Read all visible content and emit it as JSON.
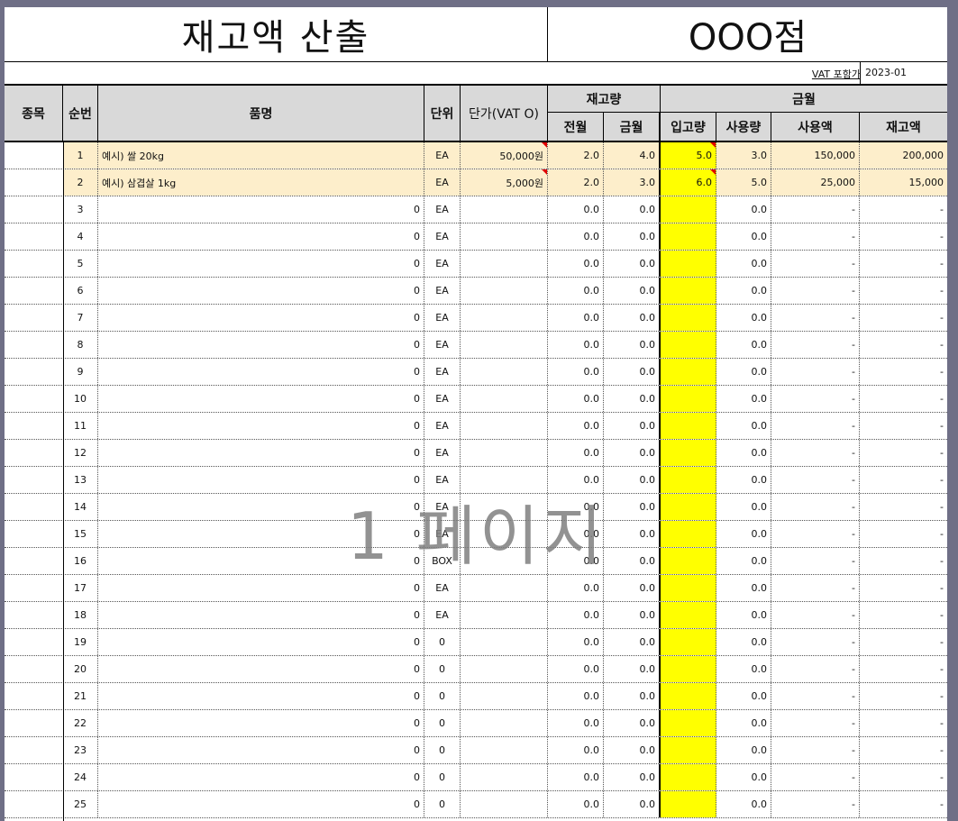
{
  "title": "재고액 산출",
  "store": "OOO점",
  "vat_label": "VAT 포함가",
  "period": "2023-01",
  "headers": {
    "category": "종목",
    "seq": "순번",
    "item": "품명",
    "unit": "단위",
    "unit_price": "단가(VAT O)",
    "stock_group": "재고량",
    "prev_month": "전월",
    "this_month": "금월",
    "amount_group": "금월",
    "inbound": "입고량",
    "usage": "사용량",
    "usage_amount": "사용액",
    "stock_amount": "재고액"
  },
  "rows": [
    {
      "seq": "1",
      "item": "예시) 쌀 20kg",
      "unit": "EA",
      "price": "50,000원",
      "prev": "2.0",
      "cur": "4.0",
      "inbound": "5.0",
      "usage": "3.0",
      "usage_amt": "150,000",
      "stock_amt": "200,000"
    },
    {
      "seq": "2",
      "item": "예시) 삼겹살 1kg",
      "unit": "EA",
      "price": "5,000원",
      "prev": "2.0",
      "cur": "3.0",
      "inbound": "6.0",
      "usage": "5.0",
      "usage_amt": "25,000",
      "stock_amt": "15,000"
    },
    {
      "seq": "3",
      "item": "0",
      "unit": "EA",
      "price": "",
      "prev": "0.0",
      "cur": "0.0",
      "inbound": "",
      "usage": "0.0",
      "usage_amt": "-",
      "stock_amt": "-"
    },
    {
      "seq": "4",
      "item": "0",
      "unit": "EA",
      "price": "",
      "prev": "0.0",
      "cur": "0.0",
      "inbound": "",
      "usage": "0.0",
      "usage_amt": "-",
      "stock_amt": "-"
    },
    {
      "seq": "5",
      "item": "0",
      "unit": "EA",
      "price": "",
      "prev": "0.0",
      "cur": "0.0",
      "inbound": "",
      "usage": "0.0",
      "usage_amt": "-",
      "stock_amt": "-"
    },
    {
      "seq": "6",
      "item": "0",
      "unit": "EA",
      "price": "",
      "prev": "0.0",
      "cur": "0.0",
      "inbound": "",
      "usage": "0.0",
      "usage_amt": "-",
      "stock_amt": "-"
    },
    {
      "seq": "7",
      "item": "0",
      "unit": "EA",
      "price": "",
      "prev": "0.0",
      "cur": "0.0",
      "inbound": "",
      "usage": "0.0",
      "usage_amt": "-",
      "stock_amt": "-"
    },
    {
      "seq": "8",
      "item": "0",
      "unit": "EA",
      "price": "",
      "prev": "0.0",
      "cur": "0.0",
      "inbound": "",
      "usage": "0.0",
      "usage_amt": "-",
      "stock_amt": "-"
    },
    {
      "seq": "9",
      "item": "0",
      "unit": "EA",
      "price": "",
      "prev": "0.0",
      "cur": "0.0",
      "inbound": "",
      "usage": "0.0",
      "usage_amt": "-",
      "stock_amt": "-"
    },
    {
      "seq": "10",
      "item": "0",
      "unit": "EA",
      "price": "",
      "prev": "0.0",
      "cur": "0.0",
      "inbound": "",
      "usage": "0.0",
      "usage_amt": "-",
      "stock_amt": "-"
    },
    {
      "seq": "11",
      "item": "0",
      "unit": "EA",
      "price": "",
      "prev": "0.0",
      "cur": "0.0",
      "inbound": "",
      "usage": "0.0",
      "usage_amt": "-",
      "stock_amt": "-"
    },
    {
      "seq": "12",
      "item": "0",
      "unit": "EA",
      "price": "",
      "prev": "0.0",
      "cur": "0.0",
      "inbound": "",
      "usage": "0.0",
      "usage_amt": "-",
      "stock_amt": "-"
    },
    {
      "seq": "13",
      "item": "0",
      "unit": "EA",
      "price": "",
      "prev": "0.0",
      "cur": "0.0",
      "inbound": "",
      "usage": "0.0",
      "usage_amt": "-",
      "stock_amt": "-"
    },
    {
      "seq": "14",
      "item": "0",
      "unit": "EA",
      "price": "",
      "prev": "0.0",
      "cur": "0.0",
      "inbound": "",
      "usage": "0.0",
      "usage_amt": "-",
      "stock_amt": "-"
    },
    {
      "seq": "15",
      "item": "0",
      "unit": "EA",
      "price": "",
      "prev": "0.0",
      "cur": "0.0",
      "inbound": "",
      "usage": "0.0",
      "usage_amt": "-",
      "stock_amt": "-"
    },
    {
      "seq": "16",
      "item": "0",
      "unit": "BOX",
      "price": "",
      "prev": "0.0",
      "cur": "0.0",
      "inbound": "",
      "usage": "0.0",
      "usage_amt": "-",
      "stock_amt": "-"
    },
    {
      "seq": "17",
      "item": "0",
      "unit": "EA",
      "price": "",
      "prev": "0.0",
      "cur": "0.0",
      "inbound": "",
      "usage": "0.0",
      "usage_amt": "-",
      "stock_amt": "-"
    },
    {
      "seq": "18",
      "item": "0",
      "unit": "EA",
      "price": "",
      "prev": "0.0",
      "cur": "0.0",
      "inbound": "",
      "usage": "0.0",
      "usage_amt": "-",
      "stock_amt": "-"
    },
    {
      "seq": "19",
      "item": "0",
      "unit": "0",
      "price": "",
      "prev": "0.0",
      "cur": "0.0",
      "inbound": "",
      "usage": "0.0",
      "usage_amt": "-",
      "stock_amt": "-"
    },
    {
      "seq": "20",
      "item": "0",
      "unit": "0",
      "price": "",
      "prev": "0.0",
      "cur": "0.0",
      "inbound": "",
      "usage": "0.0",
      "usage_amt": "-",
      "stock_amt": "-"
    },
    {
      "seq": "21",
      "item": "0",
      "unit": "0",
      "price": "",
      "prev": "0.0",
      "cur": "0.0",
      "inbound": "",
      "usage": "0.0",
      "usage_amt": "-",
      "stock_amt": "-"
    },
    {
      "seq": "22",
      "item": "0",
      "unit": "0",
      "price": "",
      "prev": "0.0",
      "cur": "0.0",
      "inbound": "",
      "usage": "0.0",
      "usage_amt": "-",
      "stock_amt": "-"
    },
    {
      "seq": "23",
      "item": "0",
      "unit": "0",
      "price": "",
      "prev": "0.0",
      "cur": "0.0",
      "inbound": "",
      "usage": "0.0",
      "usage_amt": "-",
      "stock_amt": "-"
    },
    {
      "seq": "24",
      "item": "0",
      "unit": "0",
      "price": "",
      "prev": "0.0",
      "cur": "0.0",
      "inbound": "",
      "usage": "0.0",
      "usage_amt": "-",
      "stock_amt": "-"
    },
    {
      "seq": "25",
      "item": "0",
      "unit": "0",
      "price": "",
      "prev": "0.0",
      "cur": "0.0",
      "inbound": "",
      "usage": "0.0",
      "usage_amt": "-",
      "stock_amt": "-"
    }
  ],
  "watermark": "1 페이지"
}
